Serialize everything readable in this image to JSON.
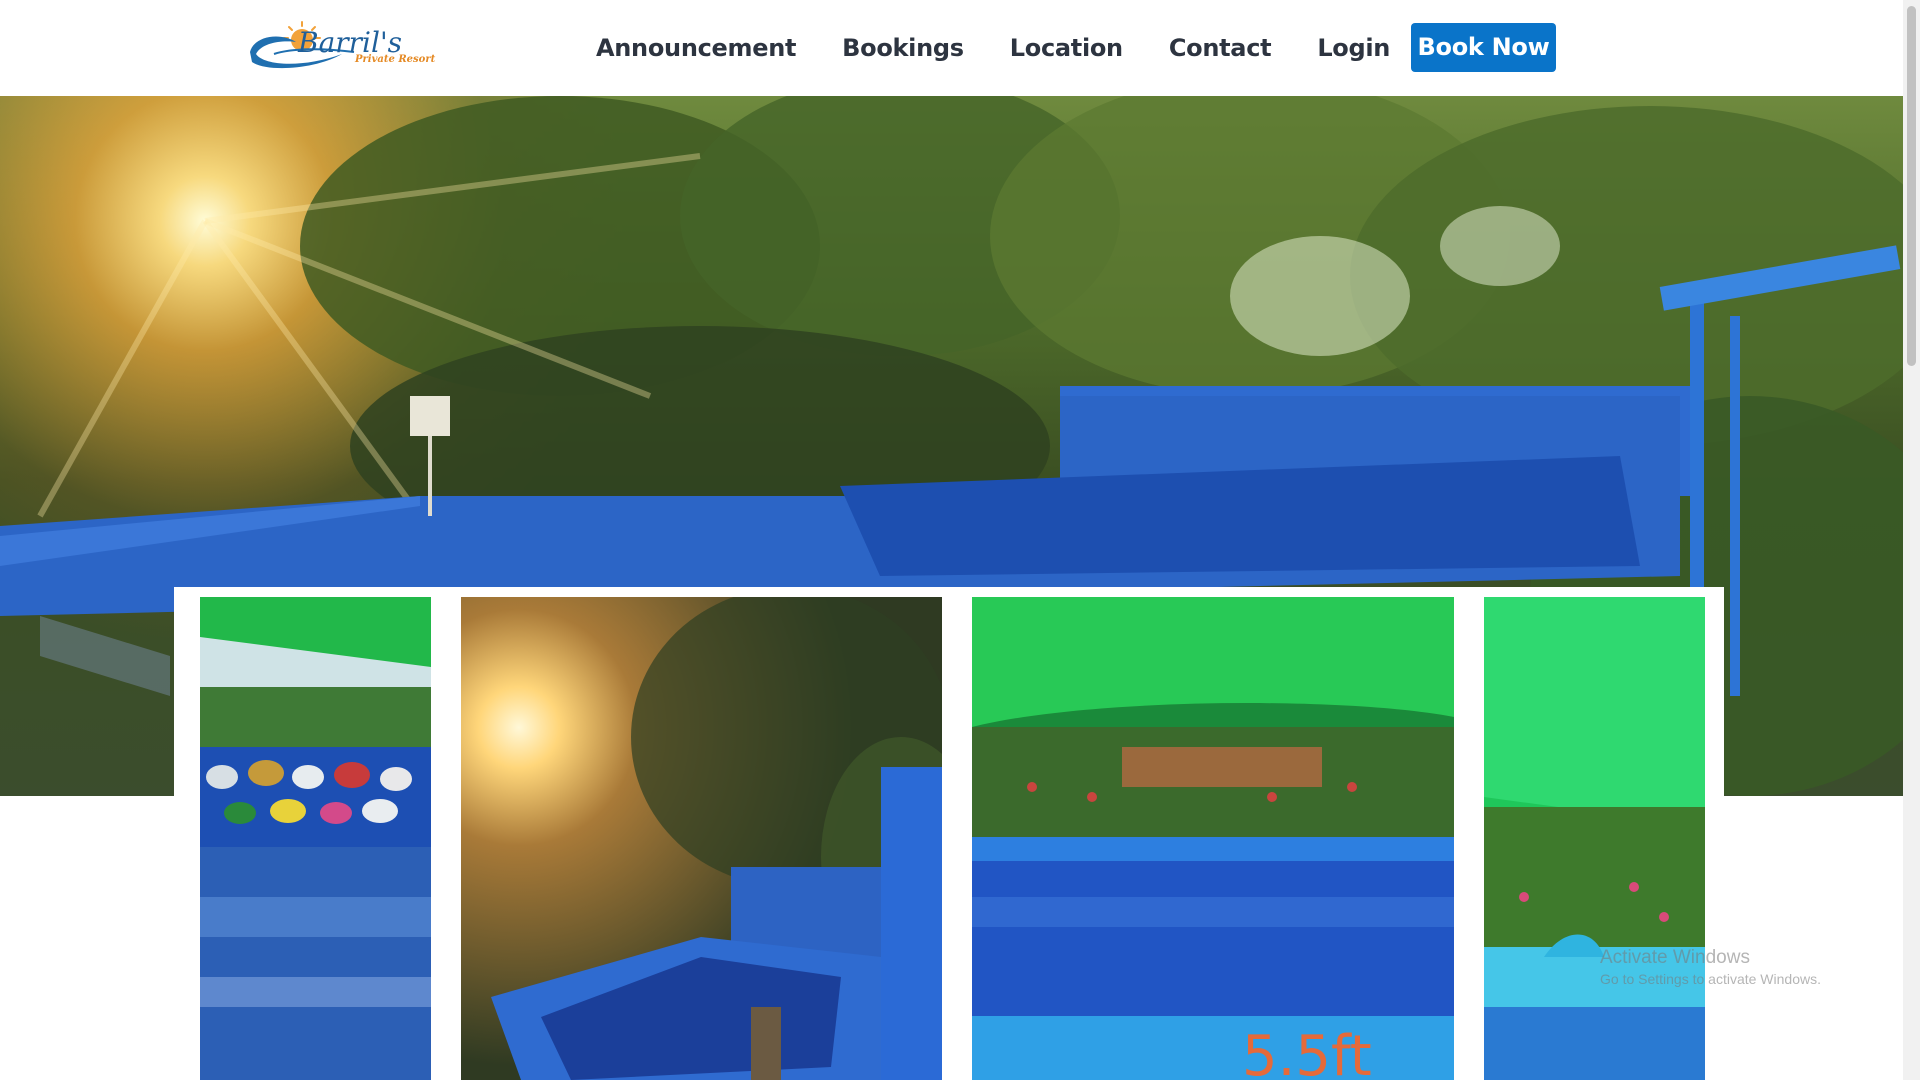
{
  "brand": {
    "logo_script": "Barril's",
    "logo_sub": "Private Resort"
  },
  "nav": {
    "items": [
      {
        "label": "Announcement"
      },
      {
        "label": "Bookings"
      },
      {
        "label": "Location"
      },
      {
        "label": "Contact"
      },
      {
        "label": "Login"
      }
    ],
    "cta_label": "Book Now"
  },
  "gallery": {
    "photo4_sign": "5.5ft"
  },
  "watermark": {
    "title": "Activate Windows",
    "subtitle": "Go to Settings to activate Windows."
  },
  "colors": {
    "cta_bg": "#0a74c9",
    "nav_text": "#2d3440",
    "pool_blue": "#2b68c7",
    "shade_green": "#1ec24a"
  }
}
